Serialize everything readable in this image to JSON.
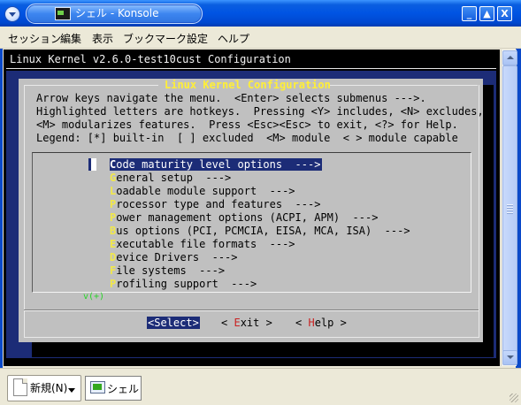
{
  "window": {
    "title": "シェル - Konsole",
    "controls": {
      "minimize": "_",
      "restore": "▲",
      "close": "X"
    }
  },
  "menubar": [
    "セッション",
    "編集",
    "表示",
    "ブックマーク",
    "設定",
    "ヘルプ"
  ],
  "terminal": {
    "header": "Linux Kernel v2.6.0-test10cust Configuration",
    "dialog_title": "Linux Kernel Configuration",
    "help_lines": [
      "Arrow keys navigate the menu.  <Enter> selects submenus --->.",
      "Highlighted letters are hotkeys.  Pressing <Y> includes, <N> excludes,",
      "<M> modularizes features.  Press <Esc><Esc> to exit, <?> for Help.",
      "Legend: [*] built-in  [ ] excluded  <M> module  < > module capable"
    ],
    "menu_items": [
      {
        "hotkey": "C",
        "rest": "ode maturity level options  --->",
        "selected": true
      },
      {
        "hotkey": "G",
        "rest": "eneral setup  --->",
        "selected": false
      },
      {
        "hotkey": "L",
        "rest": "oadable module support  --->",
        "selected": false
      },
      {
        "hotkey": "P",
        "rest": "rocessor type and features  --->",
        "selected": false
      },
      {
        "hotkey": "P",
        "rest": "ower management options (ACPI, APM)  --->",
        "selected": false
      },
      {
        "hotkey": "B",
        "rest": "us options (PCI, PCMCIA, EISA, MCA, ISA)  --->",
        "selected": false
      },
      {
        "hotkey": "E",
        "rest": "xecutable file formats  --->",
        "selected": false
      },
      {
        "hotkey": "D",
        "rest": "evice Drivers  --->",
        "selected": false
      },
      {
        "hotkey": "F",
        "rest": "ile systems  --->",
        "selected": false
      },
      {
        "hotkey": "P",
        "rest": "rofiling support  --->",
        "selected": false
      }
    ],
    "more_indicator": "v(+)",
    "buttons": {
      "select": "<Select>",
      "exit_pre": "< ",
      "exit_hotkey": "E",
      "exit_post": "xit >",
      "help_pre": "< ",
      "help_hotkey": "H",
      "help_post": "elp >"
    }
  },
  "tabbar": {
    "new_label": "新規(N)",
    "session_label": "シェル"
  },
  "colors": {
    "titlebar": "#0054e3",
    "dialog_bg": "#c0c0c0",
    "accent_blue": "#1c2c77",
    "hotkey_yellow": "#f1e84a",
    "button_hotkey_red": "#c92222"
  }
}
